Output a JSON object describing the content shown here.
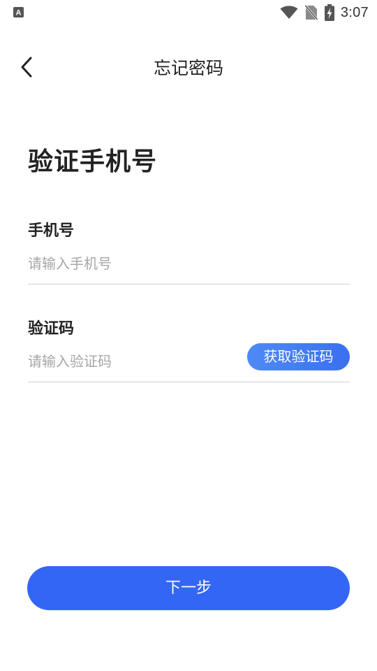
{
  "status_bar": {
    "time": "3:07",
    "icons": [
      "accessibility-a-icon",
      "wifi-icon",
      "no-sim-icon",
      "battery-charging-icon"
    ]
  },
  "header": {
    "back_icon": "chevron-left-icon",
    "title": "忘记密码"
  },
  "main": {
    "heading": "验证手机号",
    "phone": {
      "label": "手机号",
      "value": "",
      "placeholder": "请输入手机号"
    },
    "code": {
      "label": "验证码",
      "value": "",
      "placeholder": "请输入验证码",
      "get_code_label": "获取验证码"
    },
    "next_label": "下一步"
  },
  "colors": {
    "primary": "#3466f6",
    "get_code_gradient_start": "#4f8af7",
    "get_code_gradient_end": "#3a6ff0",
    "divider": "#cfcfcf",
    "placeholder": "#a6a6a6",
    "text": "#222222"
  }
}
